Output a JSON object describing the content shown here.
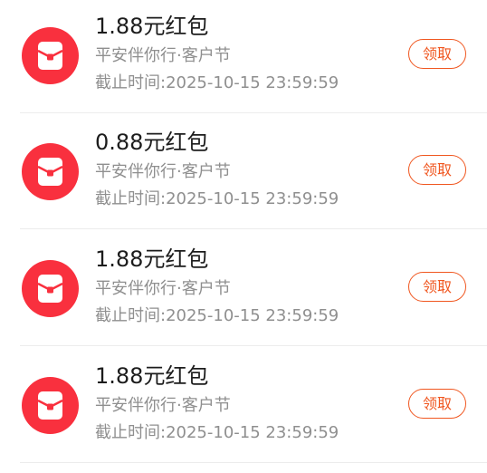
{
  "colors": {
    "icon_background": "#f9303e",
    "claim_accent": "#f0561f",
    "title_text": "#1c1c1c",
    "secondary_text": "#8f8f8f"
  },
  "items": [
    {
      "icon": "red-envelope-icon",
      "title": "1.88元红包",
      "subtitle": "平安伴你行·客户节",
      "deadline": "截止时间:2025-10-15 23:59:59",
      "button": "领取"
    },
    {
      "icon": "red-envelope-icon",
      "title": "0.88元红包",
      "subtitle": "平安伴你行·客户节",
      "deadline": "截止时间:2025-10-15 23:59:59",
      "button": "领取"
    },
    {
      "icon": "red-envelope-icon",
      "title": "1.88元红包",
      "subtitle": "平安伴你行·客户节",
      "deadline": "截止时间:2025-10-15 23:59:59",
      "button": "领取"
    },
    {
      "icon": "red-envelope-icon",
      "title": "1.88元红包",
      "subtitle": "平安伴你行·客户节",
      "deadline": "截止时间:2025-10-15 23:59:59",
      "button": "领取"
    }
  ]
}
